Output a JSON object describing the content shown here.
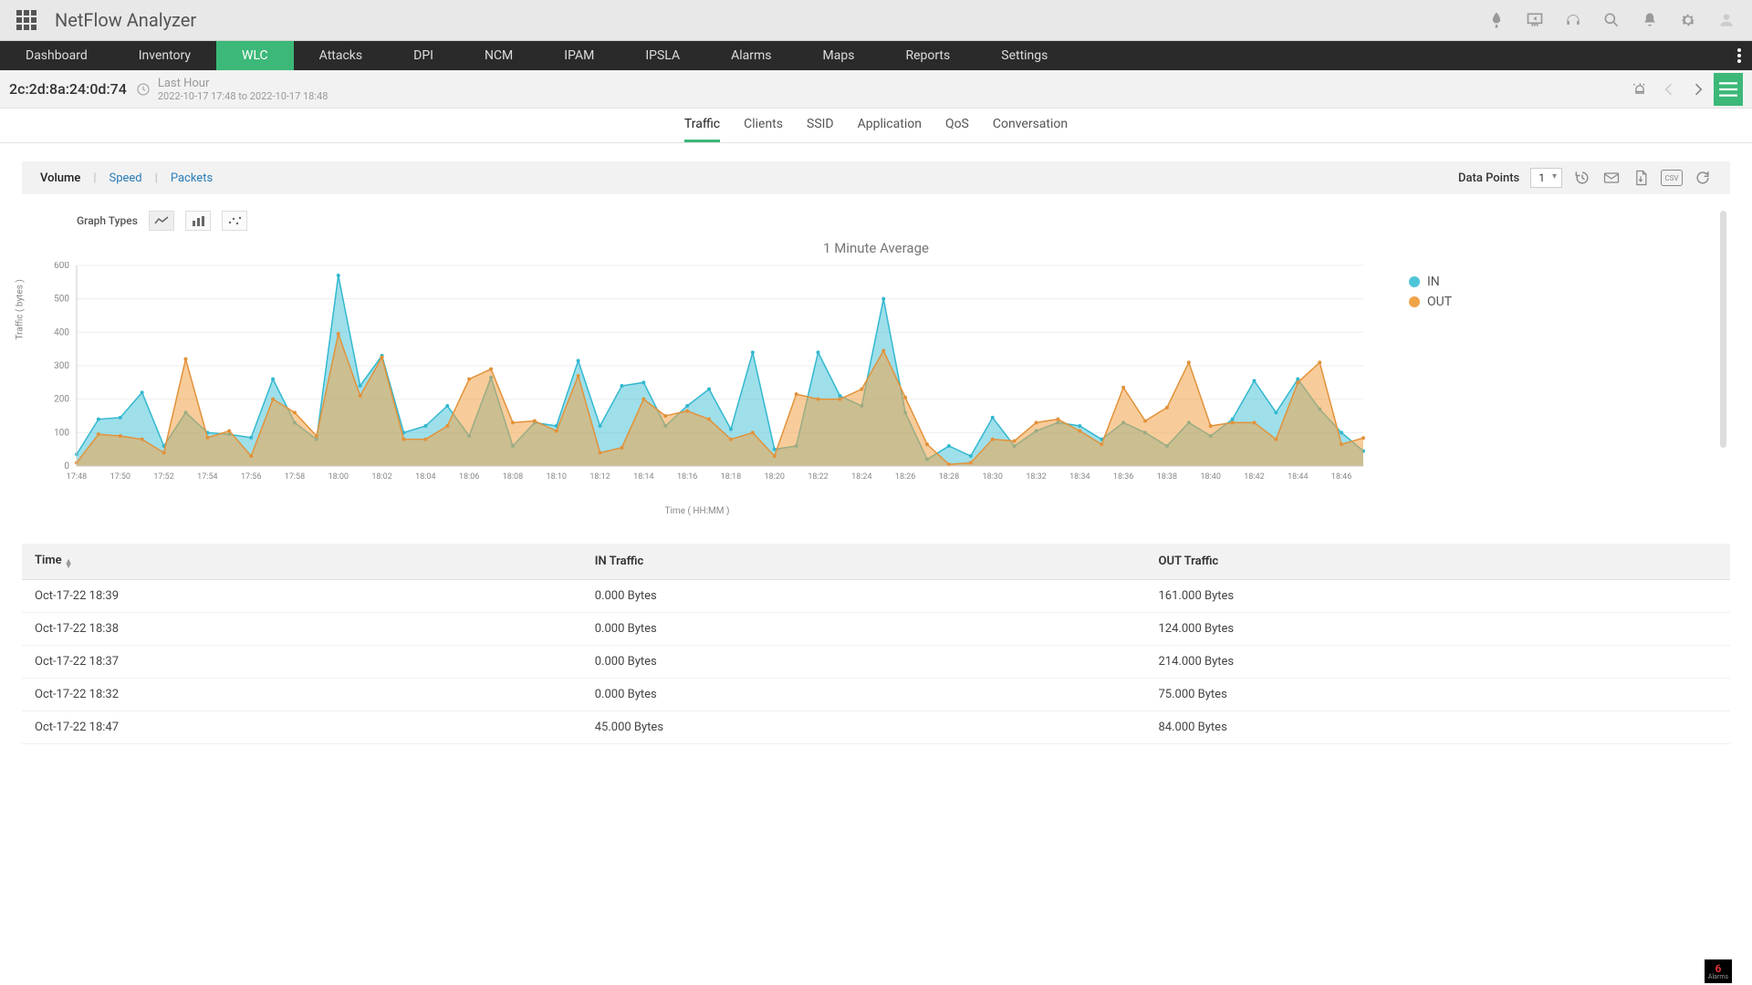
{
  "brand": "NetFlow Analyzer",
  "main_nav": [
    "Dashboard",
    "Inventory",
    "WLC",
    "Attacks",
    "DPI",
    "NCM",
    "IPAM",
    "IPSLA",
    "Alarms",
    "Maps",
    "Reports",
    "Settings"
  ],
  "main_nav_active": "WLC",
  "device": {
    "id": "2c:2d:8a:24:0d:74",
    "time_title": "Last Hour",
    "time_range": "2022-10-17 17:48 to 2022-10-17 18:48"
  },
  "sub_tabs": [
    "Traffic",
    "Clients",
    "SSID",
    "Application",
    "QoS",
    "Conversation"
  ],
  "sub_tab_active": "Traffic",
  "vsp": {
    "volume": "Volume",
    "speed": "Speed",
    "packets": "Packets"
  },
  "data_points": {
    "label": "Data Points",
    "value": "1"
  },
  "graph_types_label": "Graph Types",
  "chart_data": {
    "type": "area",
    "title": "1 Minute Average",
    "xlabel": "Time ( HH:MM )",
    "ylabel": "Traffic ( bytes )",
    "ylim": [
      0,
      600
    ],
    "yticks": [
      0,
      100,
      200,
      300,
      400,
      500,
      600
    ],
    "categories": [
      "17:48",
      "17:49",
      "17:50",
      "17:51",
      "17:52",
      "17:53",
      "17:54",
      "17:55",
      "17:56",
      "17:57",
      "17:58",
      "17:59",
      "18:00",
      "18:01",
      "18:02",
      "18:03",
      "18:04",
      "18:05",
      "18:06",
      "18:07",
      "18:08",
      "18:09",
      "18:10",
      "18:11",
      "18:12",
      "18:13",
      "18:14",
      "18:15",
      "18:16",
      "18:17",
      "18:18",
      "18:19",
      "18:20",
      "18:21",
      "18:22",
      "18:23",
      "18:24",
      "18:25",
      "18:26",
      "18:27",
      "18:28",
      "18:29",
      "18:30",
      "18:31",
      "18:32",
      "18:33",
      "18:34",
      "18:35",
      "18:36",
      "18:37",
      "18:38",
      "18:39",
      "18:40",
      "18:41",
      "18:42",
      "18:43",
      "18:44",
      "18:45",
      "18:46",
      "18:47"
    ],
    "xticks": [
      "17:48",
      "17:50",
      "17:52",
      "17:54",
      "17:56",
      "17:58",
      "18:00",
      "18:02",
      "18:04",
      "18:06",
      "18:08",
      "18:10",
      "18:12",
      "18:14",
      "18:16",
      "18:18",
      "18:20",
      "18:22",
      "18:24",
      "18:26",
      "18:28",
      "18:30",
      "18:32",
      "18:34",
      "18:36",
      "18:38",
      "18:40",
      "18:42",
      "18:44",
      "18:46"
    ],
    "series": [
      {
        "name": "IN",
        "color": "#4ec5d9",
        "values": [
          35,
          140,
          145,
          220,
          60,
          160,
          100,
          95,
          85,
          260,
          130,
          80,
          570,
          240,
          330,
          100,
          120,
          180,
          90,
          265,
          60,
          130,
          120,
          315,
          120,
          240,
          250,
          120,
          180,
          230,
          110,
          340,
          50,
          60,
          340,
          210,
          180,
          500,
          160,
          20,
          60,
          30,
          145,
          60,
          105,
          130,
          120,
          80,
          130,
          100,
          60,
          130,
          90,
          140,
          255,
          160,
          260,
          170,
          100,
          45
        ],
        "fill": "rgba(78,197,217,0.55)",
        "stroke": "#33b8cf"
      },
      {
        "name": "OUT",
        "color": "#f0a347",
        "values": [
          10,
          95,
          90,
          80,
          40,
          320,
          85,
          105,
          30,
          200,
          160,
          90,
          395,
          210,
          325,
          80,
          80,
          120,
          260,
          290,
          130,
          135,
          105,
          270,
          40,
          55,
          200,
          150,
          165,
          140,
          80,
          100,
          30,
          215,
          200,
          200,
          230,
          345,
          205,
          65,
          5,
          10,
          80,
          75,
          130,
          140,
          105,
          65,
          235,
          135,
          175,
          310,
          120,
          130,
          130,
          80,
          250,
          310,
          65,
          84
        ],
        "fill": "rgba(240,163,71,0.55)",
        "stroke": "#e2923a"
      }
    ],
    "legend": [
      {
        "name": "IN",
        "color": "#4ec5d9"
      },
      {
        "name": "OUT",
        "color": "#f0a347"
      }
    ]
  },
  "table": {
    "columns": [
      "Time",
      "IN Traffic",
      "OUT Traffic"
    ],
    "rows": [
      {
        "time": "Oct-17-22 18:39",
        "in": "0.000 Bytes",
        "out": "161.000 Bytes"
      },
      {
        "time": "Oct-17-22 18:38",
        "in": "0.000 Bytes",
        "out": "124.000 Bytes"
      },
      {
        "time": "Oct-17-22 18:37",
        "in": "0.000 Bytes",
        "out": "214.000 Bytes"
      },
      {
        "time": "Oct-17-22 18:32",
        "in": "0.000 Bytes",
        "out": "75.000 Bytes"
      },
      {
        "time": "Oct-17-22 18:47",
        "in": "45.000 Bytes",
        "out": "84.000 Bytes"
      }
    ]
  },
  "alarm": {
    "count": "6",
    "label": "Alarms"
  },
  "icons": {
    "csv": "CSV"
  }
}
